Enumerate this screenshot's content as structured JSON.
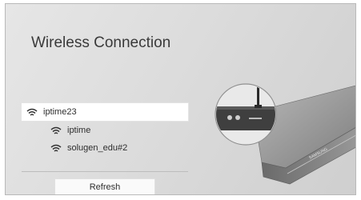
{
  "screen": {
    "title": "Wireless Connection"
  },
  "networks": [
    {
      "ssid": "iptime23",
      "icon": "wifi-icon",
      "selected": true
    },
    {
      "ssid": "iptime",
      "icon": "wifi-icon",
      "selected": false
    },
    {
      "ssid": "solugen_edu#2",
      "icon": "wifi-icon",
      "selected": false
    }
  ],
  "actions": {
    "refresh_label": "Refresh"
  },
  "device": {
    "brand_text": "SAMSUNG"
  },
  "colors": {
    "background": "#dcdcdc",
    "selection": "#ffffff",
    "text": "#2e2e2e"
  }
}
